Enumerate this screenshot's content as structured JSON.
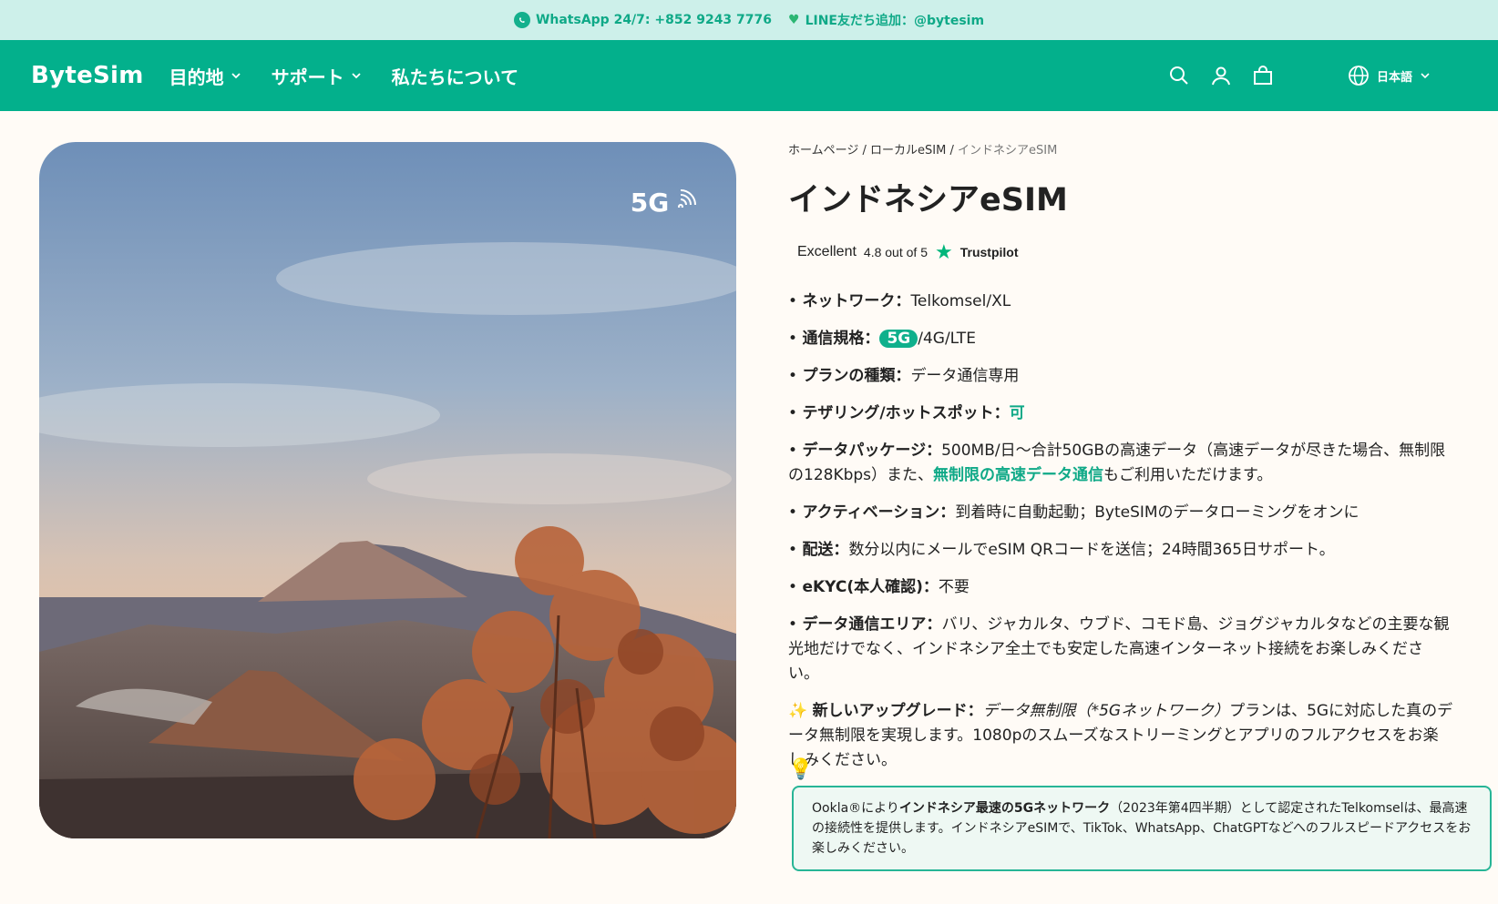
{
  "topbar": {
    "whatsapp": "WhatsApp 24/7: +852 9243 7776",
    "line": "LINE友だち追加：@bytesim"
  },
  "nav": {
    "logo": "ByteSim",
    "items": [
      {
        "label": "目的地"
      },
      {
        "label": "サポート"
      },
      {
        "label": "私たちについて"
      }
    ],
    "lang": "日本語"
  },
  "hero": {
    "badge": "5G"
  },
  "breadcrumb": {
    "home": "ホームページ",
    "sep": "/",
    "local": "ローカルeSIM",
    "current": "インドネシアeSIM"
  },
  "title": "インドネシアeSIM",
  "trustpilot": {
    "rating_word": "Excellent",
    "score": "4.8 out of 5",
    "brand": "Trustpilot"
  },
  "features": {
    "network": {
      "label": "ネットワーク：",
      "value": "Telkomsel/XL"
    },
    "standard": {
      "label": "通信規格：",
      "pill": "5G",
      "value": "/4G/LTE"
    },
    "plan": {
      "label": "プランの種類：",
      "value": "データ通信専用"
    },
    "tethering": {
      "label": "テザリング/ホットスポット：",
      "value": "可"
    },
    "package": {
      "label": "データパッケージ：",
      "value1": "500MB/日〜合計50GBの高速データ（高速データが尽きた場合、無制限の128Kbps）また、",
      "highlight": "無制限の高速データ通信",
      "value2": "もご利用いただけます。"
    },
    "activation": {
      "label": "アクティベーション：",
      "value": "到着時に自動起動；ByteSIMのデータローミングをオンに"
    },
    "delivery": {
      "label": "配送：",
      "value": "数分以内にメールでeSIM QRコードを送信；24時間365日サポート。"
    },
    "ekyc": {
      "label": "eKYC(本人確認)：",
      "value": "不要"
    },
    "area": {
      "label": "データ通信エリア：",
      "value": "バリ、ジャカルタ、ウブド、コモド島、ジョグジャカルタなどの主要な観光地だけでなく、インドネシア全土でも安定した高速インターネット接続をお楽しみください。"
    },
    "upgrade": {
      "emoji": "✨",
      "label": "新しいアップグレード：",
      "italic": "データ無制限（*5Gネットワーク）",
      "value": "プランは、5Gに対応した真のデータ無制限を実現します。1080pのスムーズなストリーミングとアプリのフルアクセスをお楽しみください。"
    }
  },
  "note": {
    "bulb": "💡",
    "pre": "Ookla®により",
    "bold": "インドネシア最速の5Gネットワーク",
    "post": "（2023年第4四半期）として認定されたTelkomselは、最高速の接続性を提供します。インドネシアeSIMで、TikTok、WhatsApp、ChatGPTなどへのフルスピードアクセスをお楽しみください。"
  },
  "colors": {
    "brand": "#03b08c",
    "accent": "#0fa987",
    "topbar": "#cdf0ea",
    "page": "#fffbf6"
  }
}
